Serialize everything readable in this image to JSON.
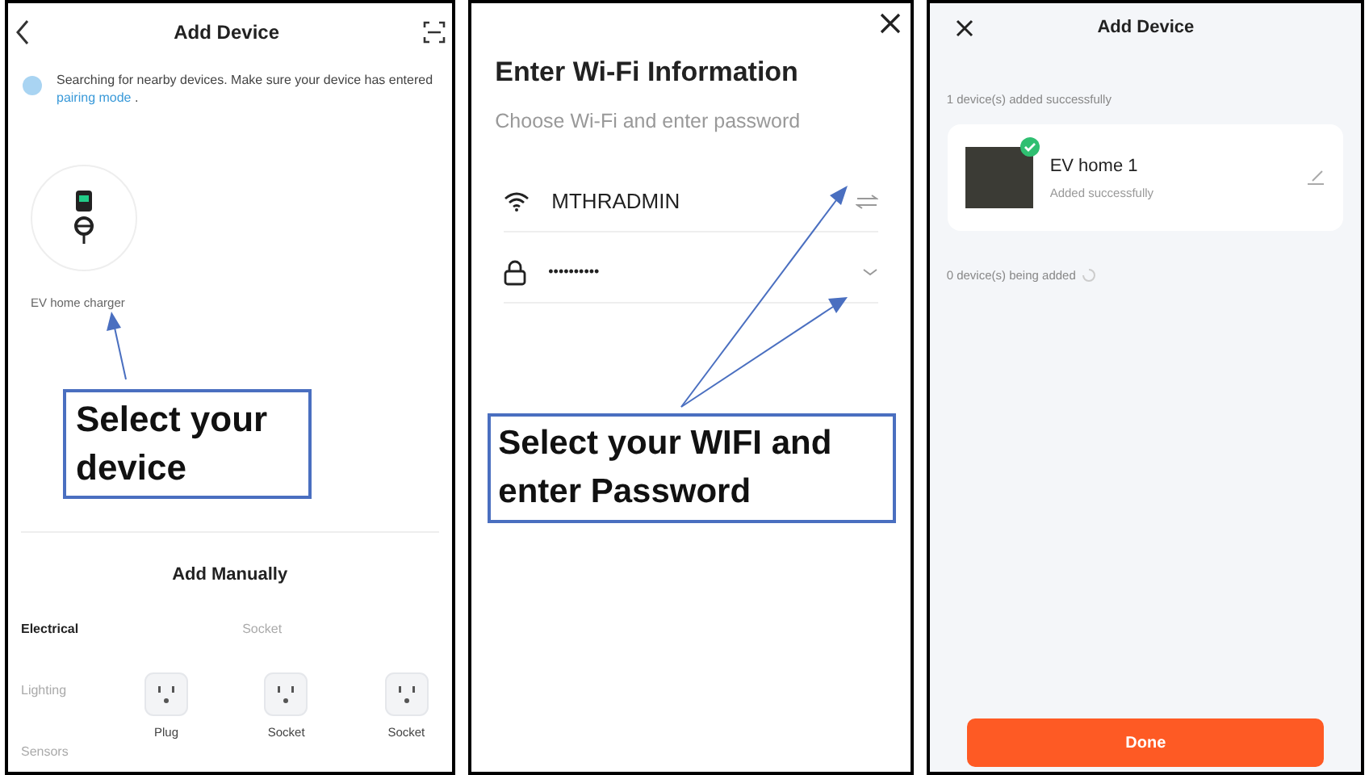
{
  "add_device": {
    "title": "Add Device",
    "notice": "Searching for nearby devices. Make sure your device has entered",
    "notice_link": "pairing mode",
    "notice_end": ".",
    "found": [
      {
        "name": "EV home charger"
      }
    ],
    "manual_title": "Add Manually",
    "categories": [
      {
        "label": "Electrical",
        "selected": true
      },
      {
        "label": "Lighting",
        "selected": false
      },
      {
        "label": "Sensors",
        "selected": false
      }
    ],
    "group_label": "Socket",
    "products": [
      {
        "label": "Plug"
      },
      {
        "label": "Socket"
      },
      {
        "label": "Socket"
      }
    ],
    "callout": "Select your device"
  },
  "wifi": {
    "title": "Enter Wi-Fi Information",
    "subtitle": "Choose Wi-Fi and enter password",
    "network": "MTHRADMIN",
    "password": "••••••••••",
    "callout": "Select your WIFI and enter Password"
  },
  "result": {
    "title": "Add Device",
    "added_label": "1 device(s) added successfully",
    "devices": [
      {
        "name": "EV home 1",
        "status": "Added successfully"
      }
    ],
    "pending_label": "0 device(s) being added",
    "done": "Done"
  }
}
